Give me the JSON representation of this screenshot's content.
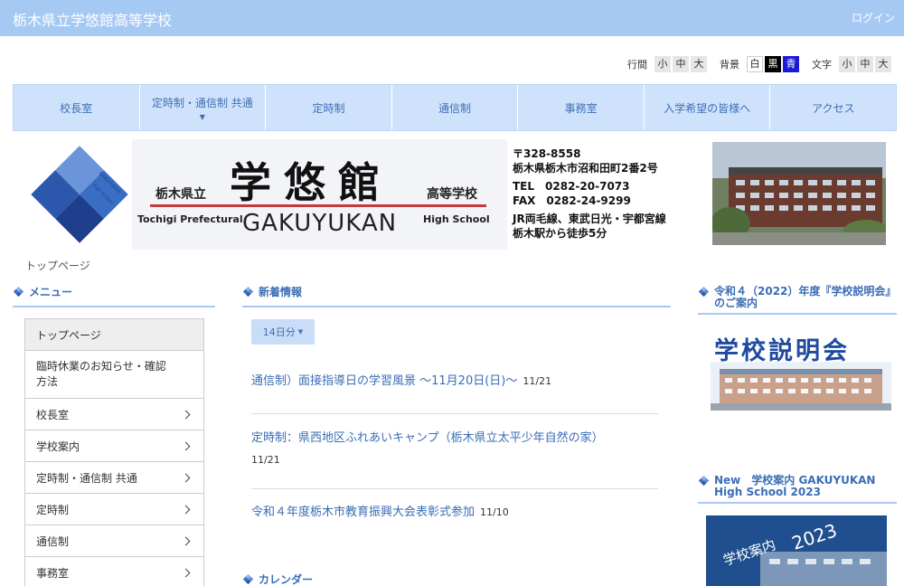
{
  "header": {
    "site_title": "栃木県立学悠館高等学校",
    "login": "ログイン"
  },
  "tools": {
    "line_spacing": {
      "label": "行間",
      "options": [
        "小",
        "中",
        "大"
      ]
    },
    "background": {
      "label": "背景",
      "options": [
        "白",
        "黒",
        "青"
      ]
    },
    "text_size": {
      "label": "文字",
      "options": [
        "小",
        "中",
        "大"
      ]
    }
  },
  "nav": [
    "校長室",
    "定時制・通信制 共通",
    "定時制",
    "通信制",
    "事務室",
    "入学希望の皆様へ",
    "アクセス"
  ],
  "banner": {
    "kenritsu": "栃木県立",
    "main": "学悠館",
    "koto": "高等学校",
    "tochigi": "Tochigi Prefectural",
    "gakuyukan": "GAKUYUKAN",
    "high_school": "High School"
  },
  "logo": {
    "text1": "GAKUYUKAN",
    "text2": "High School"
  },
  "address": {
    "zip": "〒328-8558",
    "addr": "栃木県栃木市沼和田町2番2号",
    "tel": "TEL　0282-20-7073",
    "fax": "FAX　0282-24-9299",
    "access1": "JR両毛線、東武日光・宇都宮線",
    "access2": "栃木駅から徒歩5分"
  },
  "breadcrumb": "トップページ",
  "menu": {
    "title": "メニュー",
    "items": [
      "トップページ",
      "臨時休業のお知らせ・確認方法",
      "校長室",
      "学校案内",
      "定時制・通信制 共通",
      "定時制",
      "通信制",
      "事務室"
    ]
  },
  "news": {
    "title": "新着情報",
    "filter": "14日分",
    "items": [
      {
        "title": "通信制）面接指導日の学習風景 〜11月20日(日)〜",
        "date": "11/21"
      },
      {
        "title": "定時制：県西地区ふれあいキャンプ（栃木県立太平少年自然の家）",
        "date": "11/21"
      },
      {
        "title": "令和４年度栃木市教育振興大会表彰式参加",
        "date": "11/10"
      }
    ]
  },
  "calendar": {
    "title": "カレンダー"
  },
  "right": {
    "sec1_title": "令和４（2022）年度『学校説明会』のご案内",
    "banner1_text": "学校説明会",
    "sec2_title": "New　学校案内 GAKUYUKAN High School 2023",
    "banner2_year": "2023",
    "banner2_text": "学校案内"
  },
  "colors": {
    "header_bg": "#a6c9f4",
    "nav_bg": "#cfe2fb",
    "link": "#3a6db5"
  }
}
